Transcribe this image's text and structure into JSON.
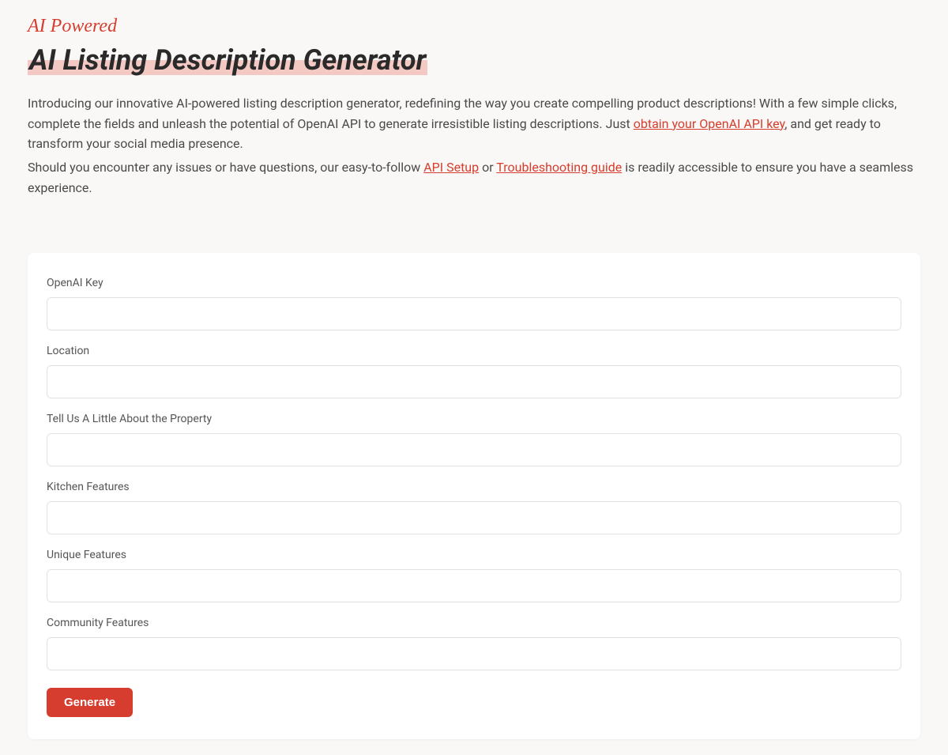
{
  "header": {
    "tagline": "AI Powered",
    "title": "AI Listing Description Generator",
    "intro_part1": "Introducing our innovative AI-powered listing description generator, redefining the way you create compelling product descriptions! With a few simple clicks, complete the fields and unleash the potential of OpenAI API to generate irresistible listing descriptions. Just ",
    "link_obtain_key": "obtain your OpenAI API key",
    "intro_part2": ", and get ready to transform your social media presence.",
    "intro2_part1": "Should you encounter any issues or have questions, our easy-to-follow ",
    "link_api_setup": "API Setup",
    "intro2_or": " or ",
    "link_troubleshooting": "Troubleshooting guide",
    "intro2_part2": " is readily accessible to ensure you have a seamless experience."
  },
  "form": {
    "fields": [
      {
        "label": "OpenAI Key",
        "value": ""
      },
      {
        "label": "Location",
        "value": ""
      },
      {
        "label": "Tell Us A Little About the Property",
        "value": ""
      },
      {
        "label": "Kitchen Features",
        "value": ""
      },
      {
        "label": "Unique Features",
        "value": ""
      },
      {
        "label": "Community Features",
        "value": ""
      }
    ],
    "submit_label": "Generate"
  }
}
